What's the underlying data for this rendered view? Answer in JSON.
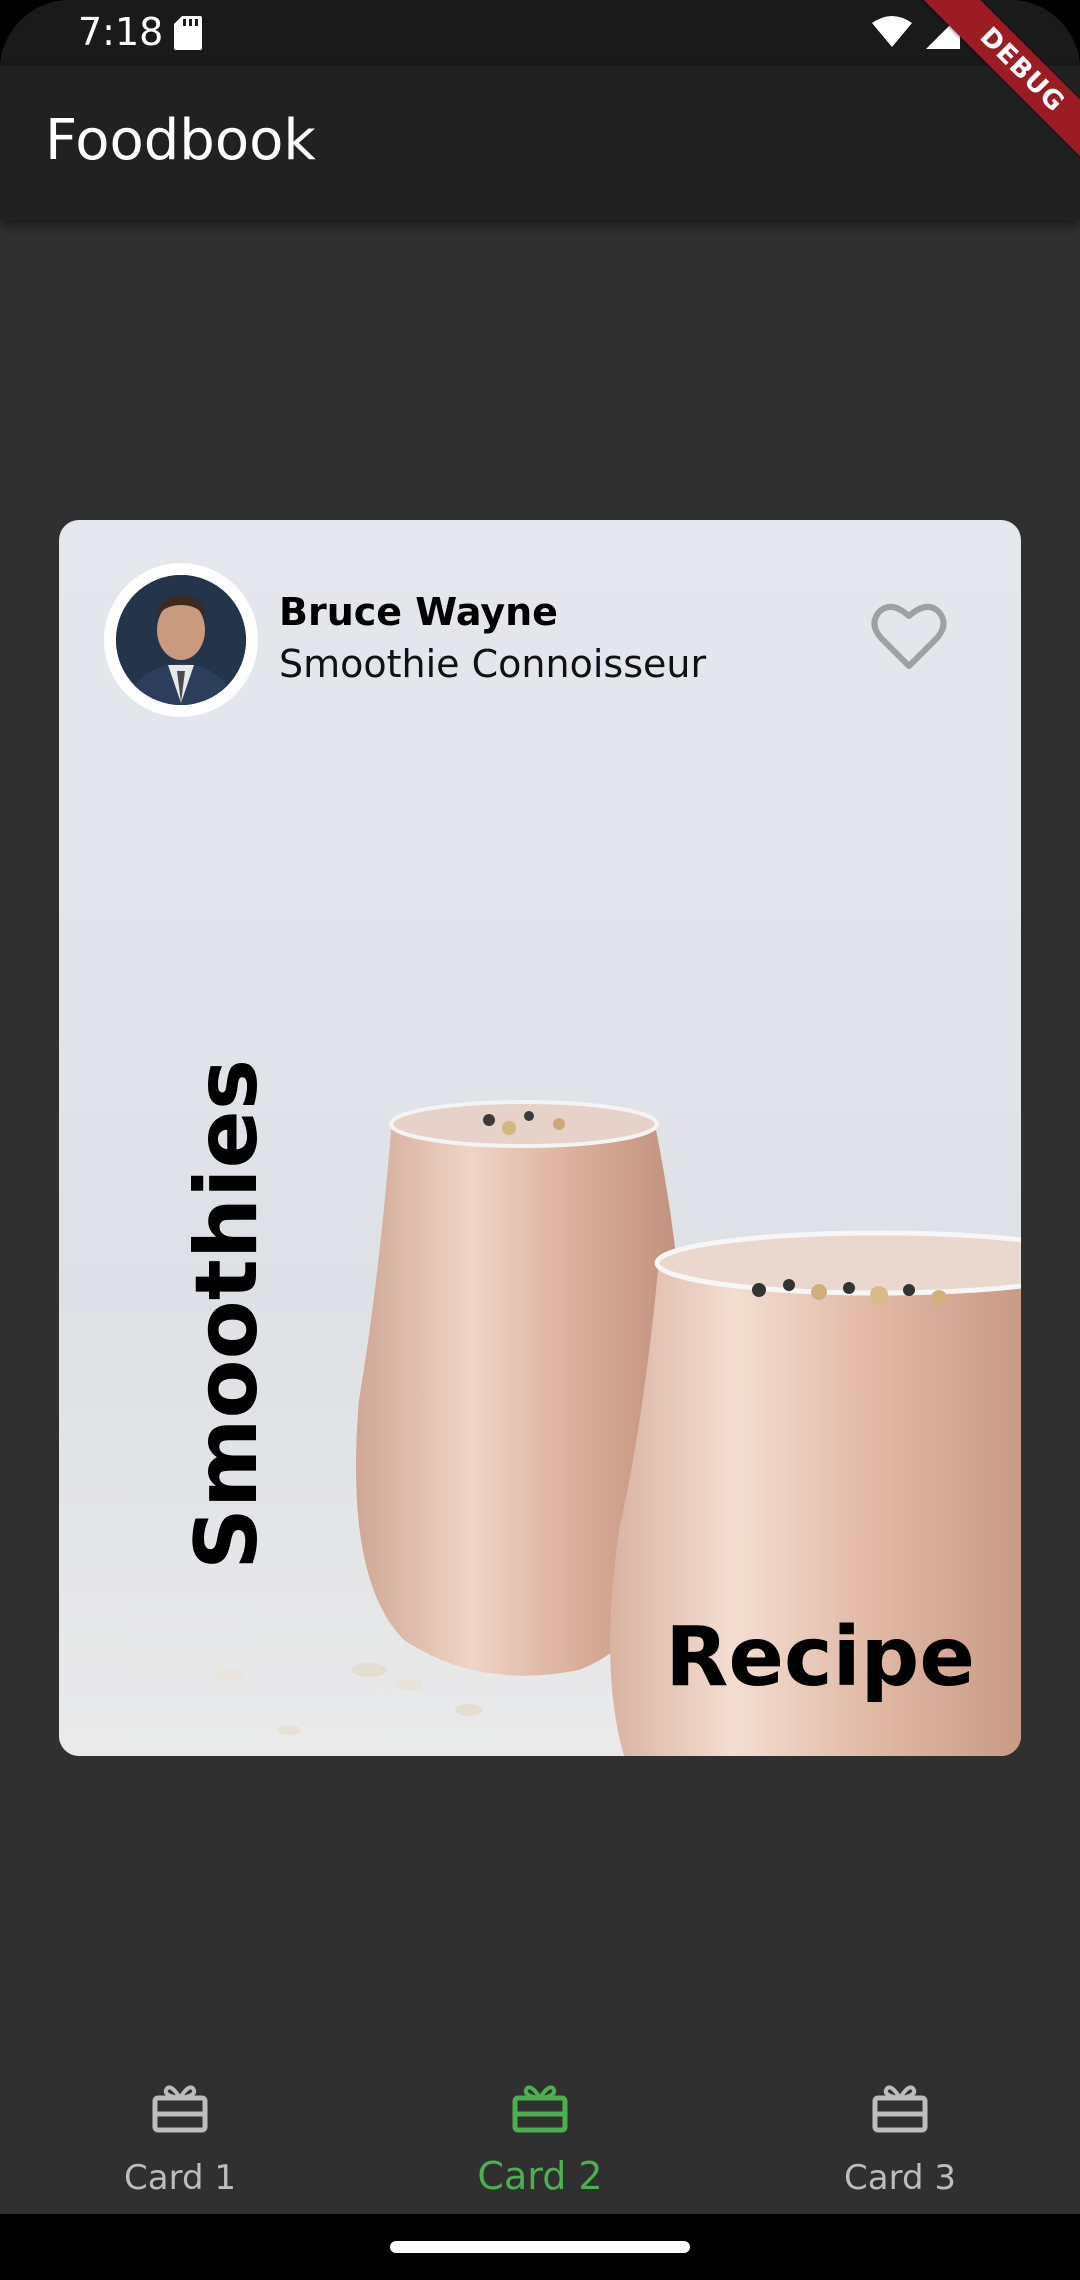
{
  "status_bar": {
    "time": "7:18"
  },
  "debug_banner": "DEBUG",
  "app_bar": {
    "title": "Foodbook"
  },
  "card": {
    "author_name": "Bruce Wayne",
    "author_title": "Smoothie Connoisseur",
    "vertical_word": "Smoothies",
    "bottom_word": "Recipe",
    "favorite_icon": "heart-outline-icon"
  },
  "bottom_nav": {
    "items": [
      {
        "label": "Card 1",
        "icon": "card-giftcard-icon",
        "active": false
      },
      {
        "label": "Card 2",
        "icon": "card-giftcard-icon",
        "active": true
      },
      {
        "label": "Card 3",
        "icon": "card-giftcard-icon",
        "active": false
      }
    ]
  },
  "colors": {
    "accent": "#4caf50",
    "background": "#303030",
    "app_bar": "#212121"
  }
}
